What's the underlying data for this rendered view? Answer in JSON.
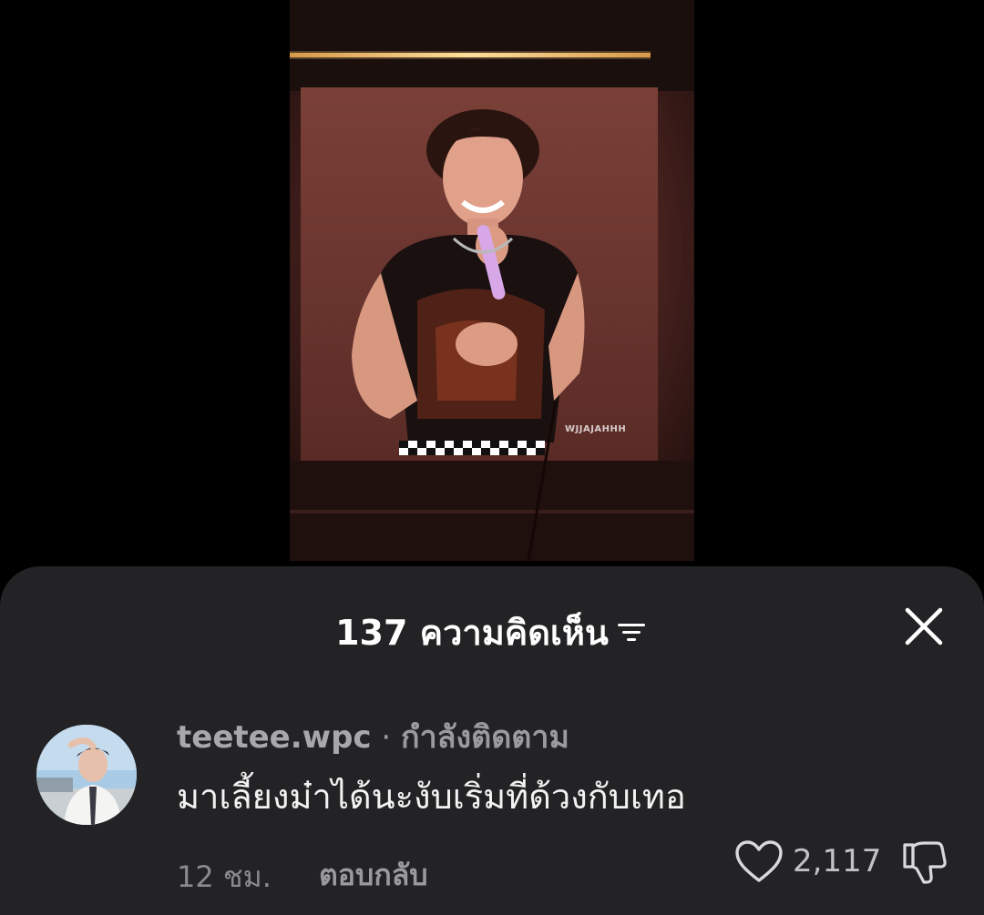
{
  "post": {
    "photo_icon": "concert-photo",
    "watermark": "WJJAJAHHH"
  },
  "comments_sheet": {
    "title": "137 ความคิดเห็น",
    "sort_icon": "sort-filter-icon",
    "close_icon": "close-icon"
  },
  "comment": {
    "username": "teetee.wpc",
    "separator": " · ",
    "follow_status": "กำลังติดตาม",
    "text": "มาเลี้ยงม๋าได้นะงับเริ่มที่ด้วงกับเทอ",
    "time": "12 ชม.",
    "reply_label": "ตอบกลับ",
    "like_count": "2,117",
    "like_icon": "heart-outline-icon",
    "dislike_icon": "thumbs-down-icon"
  },
  "colors": {
    "sheet_background": "#232325",
    "page_background": "#000000",
    "text_primary": "#ffffff",
    "text_secondary": "#9b9b9f"
  }
}
